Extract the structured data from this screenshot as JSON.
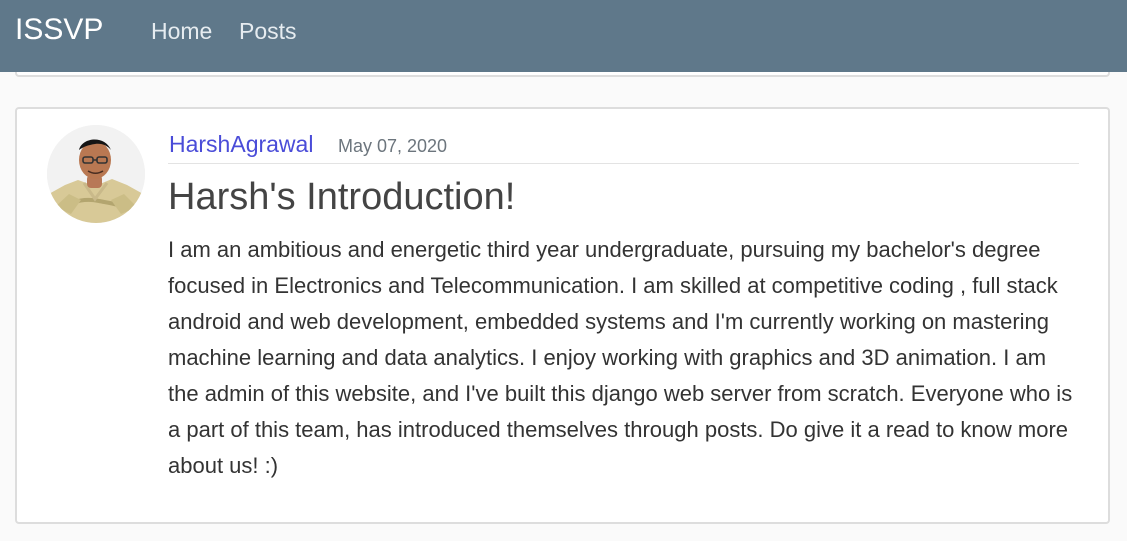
{
  "header": {
    "brand": "ISSVP",
    "nav": {
      "home": "Home",
      "posts": "Posts"
    },
    "background_color": "#5f788a"
  },
  "post": {
    "author": "HarshAgrawal",
    "date": "May 07, 2020",
    "title": "Harsh's Introduction!",
    "content": "I am an ambitious and energetic third year undergraduate, pursuing my bachelor's degree focused in Electronics and Telecommunication. I am skilled at competitive coding , full stack android and web development, embedded systems and I'm currently working on mastering machine learning and data analytics. I enjoy working with graphics and 3D animation. I am the admin of this website, and I've built this django web server from scratch. Everyone who is a part of this team, has introduced themselves through posts. Do give it a read to know more about us! :)",
    "author_color": "#4a4cd8"
  }
}
